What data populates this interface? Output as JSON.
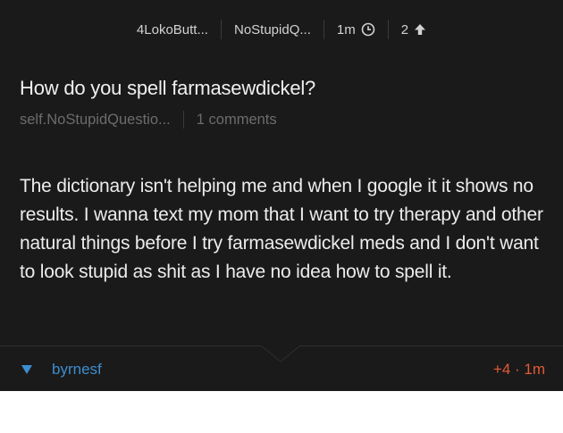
{
  "meta": {
    "author": "4LokoButt...",
    "subreddit": "NoStupidQ...",
    "time": "1m",
    "votes": "2"
  },
  "post": {
    "title": "How do you spell farmasewdickel?",
    "domain": "self.NoStupidQuestio...",
    "comments": "1 comments",
    "body": "The dictionary isn't helping me and when I google it it shows no results. I wanna text my mom that I want to try therapy and other natural things before I try farmasewdickel meds and I don't want to look stupid as shit as I have no idea how to spell it."
  },
  "comment": {
    "author": "byrnesf",
    "score": "+4 · 1m"
  },
  "colors": {
    "background": "#1a1a1a",
    "accent_blue": "#3d8ecf",
    "accent_orange": "#e15a36"
  },
  "icons": [
    "clock-icon",
    "arrow-up-icon",
    "collapse-triangle-icon"
  ]
}
